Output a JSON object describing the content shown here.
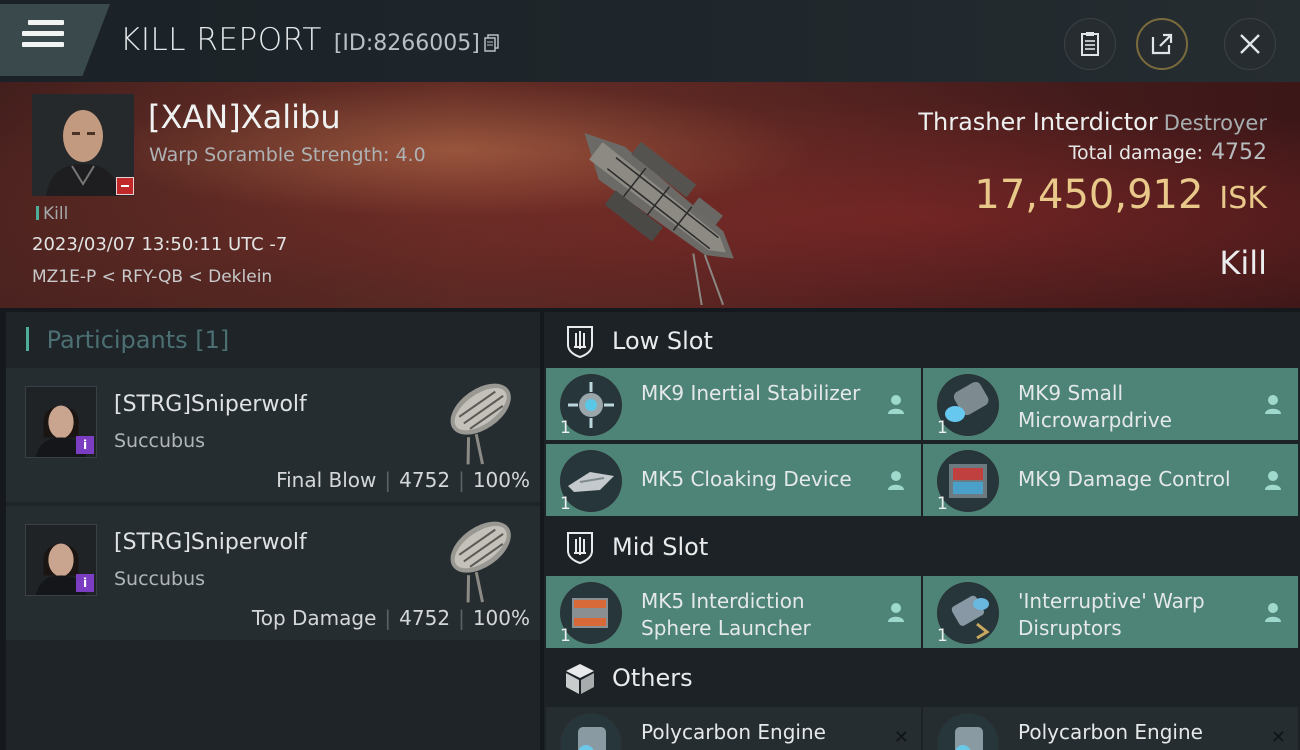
{
  "header": {
    "title": "KILL REPORT",
    "report_id": "[ID:8266005]"
  },
  "victim": {
    "name": "[XAN]Xalibu",
    "subtitle": "Warp Soramble Strength: 4.0",
    "tag": "Kill",
    "timestamp": "2023/03/07 13:50:11 UTC -7",
    "location": "MZ1E-P < RFY-QB < Deklein",
    "ship_name": "Thrasher Interdictor",
    "ship_class": "Destroyer",
    "total_damage_label": "Total damage:",
    "total_damage": "4752",
    "isk_value": "17,450,912",
    "isk_unit": "ISK",
    "result": "Kill"
  },
  "participants": {
    "title": "Participants",
    "count": "[1]",
    "items": [
      {
        "name": "[STRG]Sniperwolf",
        "ship": "Succubus",
        "role": "Final Blow",
        "damage": "4752",
        "percent": "100%"
      },
      {
        "name": "[STRG]Sniperwolf",
        "ship": "Succubus",
        "role": "Top Damage",
        "damage": "4752",
        "percent": "100%"
      }
    ]
  },
  "fitting": {
    "low_slot_label": "Low Slot",
    "mid_slot_label": "Mid Slot",
    "others_label": "Others",
    "low": [
      {
        "name": "MK9 Inertial Stabilizer",
        "qty": "1"
      },
      {
        "name": "MK9 Small Microwarpdrive",
        "qty": "1"
      },
      {
        "name": "MK5 Cloaking Device",
        "qty": "1"
      },
      {
        "name": "MK9 Damage Control",
        "qty": "1"
      }
    ],
    "mid": [
      {
        "name": "MK5 Interdiction Sphere Launcher",
        "qty": "1"
      },
      {
        "name": "'Interruptive' Warp Disruptors",
        "qty": "1"
      }
    ],
    "others": [
      {
        "name": "Polycarbon Engine"
      },
      {
        "name": "Polycarbon Engine"
      }
    ]
  },
  "colors": {
    "slot_teal": "#4e8478",
    "isk_gold": "#e8c98a",
    "accent": "#4fae9a",
    "corp_badge_purple": "#7b3dc2",
    "alert_red": "#c0282a"
  }
}
